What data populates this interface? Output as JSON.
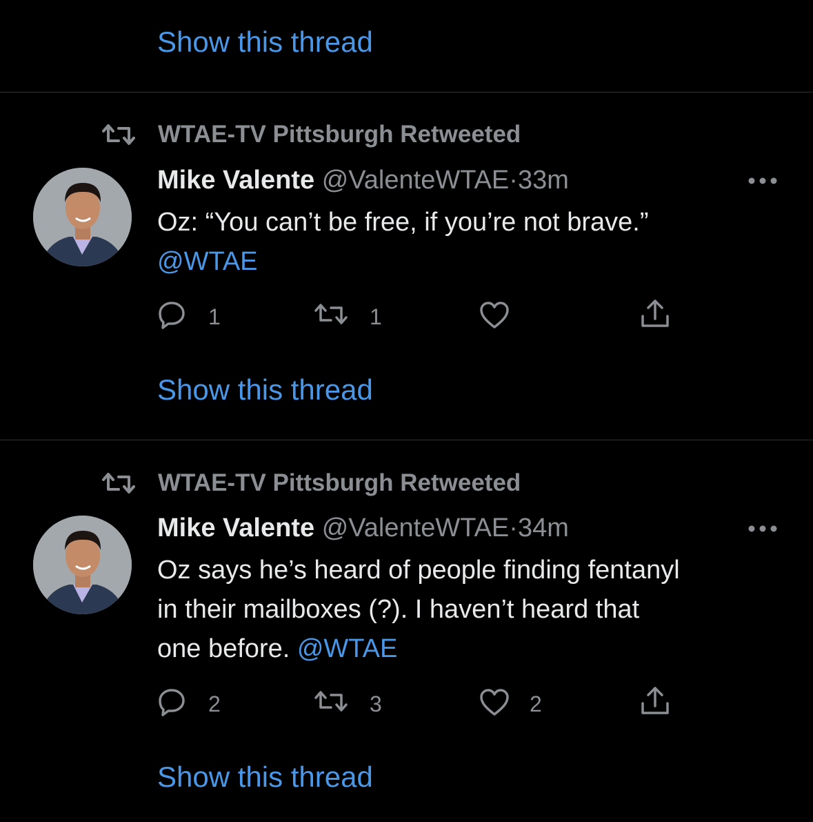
{
  "top": {
    "show_thread": "Show this thread"
  },
  "tweets": [
    {
      "retweeted_by": "WTAE-TV Pittsburgh Retweeted",
      "name": "Mike Valente",
      "handle": "@ValenteWTAE",
      "separator": "·",
      "time": "33m",
      "text_line1": "Oz: “You can’t be free, if you’re not brave.”",
      "mention": "@WTAE",
      "replies": "1",
      "retweets": "1",
      "likes": "",
      "show_thread": "Show this thread"
    },
    {
      "retweeted_by": "WTAE-TV Pittsburgh Retweeted",
      "name": "Mike Valente",
      "handle": "@ValenteWTAE",
      "separator": "·",
      "time": "34m",
      "text_line1": "Oz says he’s heard of people finding fentanyl",
      "text_line2": "in their mailboxes (?). I haven’t heard that",
      "text_line3_prefix": "one before. ",
      "mention": "@WTAE",
      "replies": "2",
      "retweets": "3",
      "likes": "2",
      "show_thread": "Show this thread"
    }
  ],
  "colors": {
    "background": "#000000",
    "link": "#4a97e8",
    "muted": "#8b8f93",
    "text": "#e7e9ea"
  }
}
